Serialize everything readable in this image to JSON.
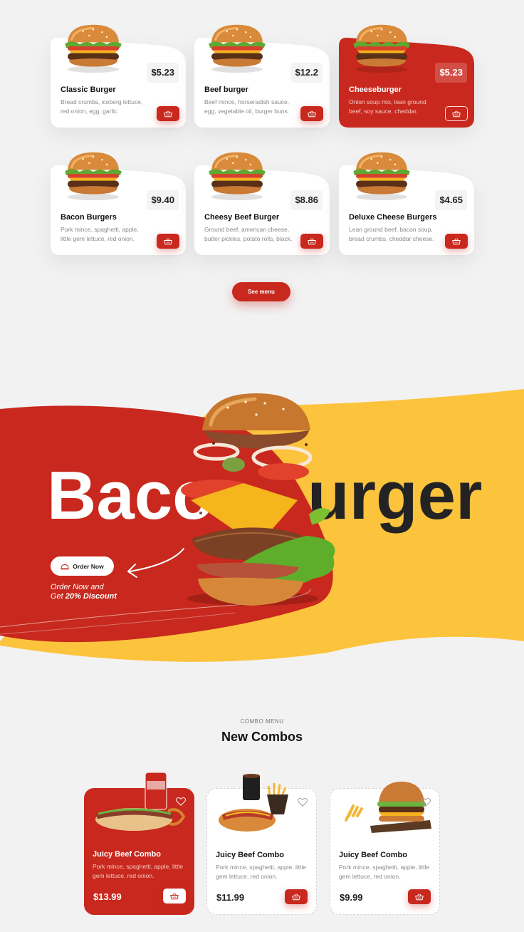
{
  "colors": {
    "brand_red": "#c8281d",
    "brand_yellow": "#fcc33c",
    "dark_text": "#222222",
    "background": "#f2f2f2"
  },
  "menu": {
    "items": [
      {
        "name": "Classic Burger",
        "price": "$5.23",
        "desc": "Bread crumbs, iceberg lettuce, red onion, egg, garlic.",
        "icon": "cart-icon"
      },
      {
        "name": "Beef burger",
        "price": "$12.2",
        "desc": "Beef mince, horseradish sauce, egg, vegetable oil, burger buns.",
        "icon": "cart-icon"
      },
      {
        "name": "Cheeseburger",
        "price": "$5.23",
        "desc": "Onion soup mix, lean ground beef, soy sauce, cheddar.",
        "icon": "cart-icon",
        "active": true
      },
      {
        "name": "Bacon Burgers",
        "price": "$9.40",
        "desc": "Pork mince, spaghetti, apple, little gem lettuce, red onion.",
        "icon": "cart-icon"
      },
      {
        "name": "Cheesy Beef Burger",
        "price": "$8.86",
        "desc": "Ground beef, american cheese, butter pickles, potato rolls, black.",
        "icon": "cart-icon"
      },
      {
        "name": "Deluxe Cheese Burgers",
        "price": "$4.65",
        "desc": "Lean ground beef, bacon soup, bread crumbs, cheddar cheese.",
        "icon": "cart-icon"
      }
    ],
    "see_menu_label": "See menu"
  },
  "hero": {
    "title_left": "Baco",
    "title_right": "urger",
    "order_button_label": "Order Now",
    "order_icon": "cloche-icon",
    "note_line1": "Order Now and",
    "note_line2_prefix": "Get ",
    "note_line2_bold": "20% Discount"
  },
  "combos": {
    "tag": "COMBO MENU",
    "title": "New Combos",
    "items": [
      {
        "name": "Juicy Beef Combo",
        "desc": "Pork mince, spaghetti, apple, little gem lettuce, red onion.",
        "price": "$13.99",
        "active": true,
        "icon": "heart-icon"
      },
      {
        "name": "Juicy Beef Combo",
        "desc": "Pork mince, spaghetti, apple, little gem lettuce, red onion.",
        "price": "$11.99",
        "icon": "heart-icon"
      },
      {
        "name": "Juicy Beef Combo",
        "desc": "Pork mince, spaghetti, apple, little gem lettuce, red onion.",
        "price": "$9.99",
        "icon": "heart-icon"
      }
    ]
  }
}
